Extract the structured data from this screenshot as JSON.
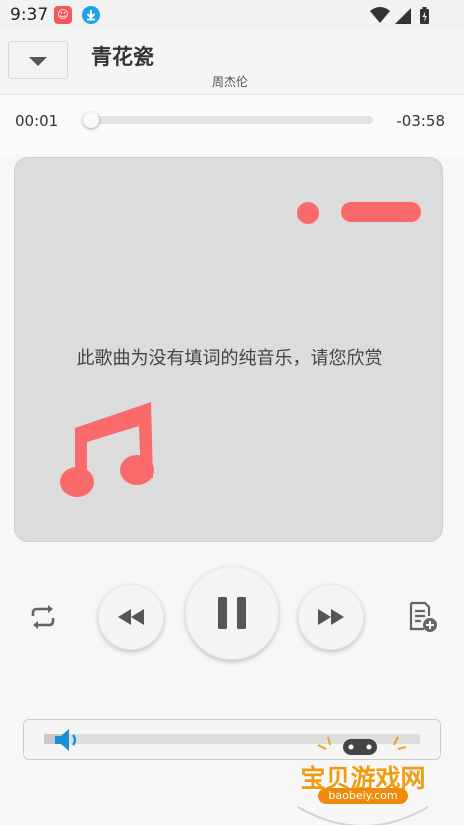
{
  "status_bar": {
    "time": "9:37",
    "icons": [
      "app-notification-icon",
      "download-icon",
      "wifi-icon",
      "signal-icon",
      "battery-icon"
    ]
  },
  "header": {
    "collapse_icon": "chevron-down-icon",
    "title": "青花瓷",
    "artist": "周杰伦"
  },
  "playback": {
    "current_time": "00:01",
    "remaining_time": "-03:58",
    "progress_fraction": 0.004
  },
  "lyrics": {
    "message": "此歌曲为没有填词的纯音乐，请您欣赏",
    "icon": "music-note-icon"
  },
  "controls": {
    "repeat_icon": "repeat-icon",
    "previous_icon": "rewind-icon",
    "play_state_icon": "pause-icon",
    "next_icon": "fast-forward-icon",
    "playlist_icon": "add-to-playlist-icon"
  },
  "volume": {
    "icon": "speaker-icon",
    "level_fraction": 0.06
  },
  "watermark": {
    "title": "宝贝游戏网",
    "url": "baobeiy.com"
  },
  "colors": {
    "accent": "#fb6a6a",
    "speaker": "#1b8fd8",
    "watermark": "#f29a10"
  }
}
